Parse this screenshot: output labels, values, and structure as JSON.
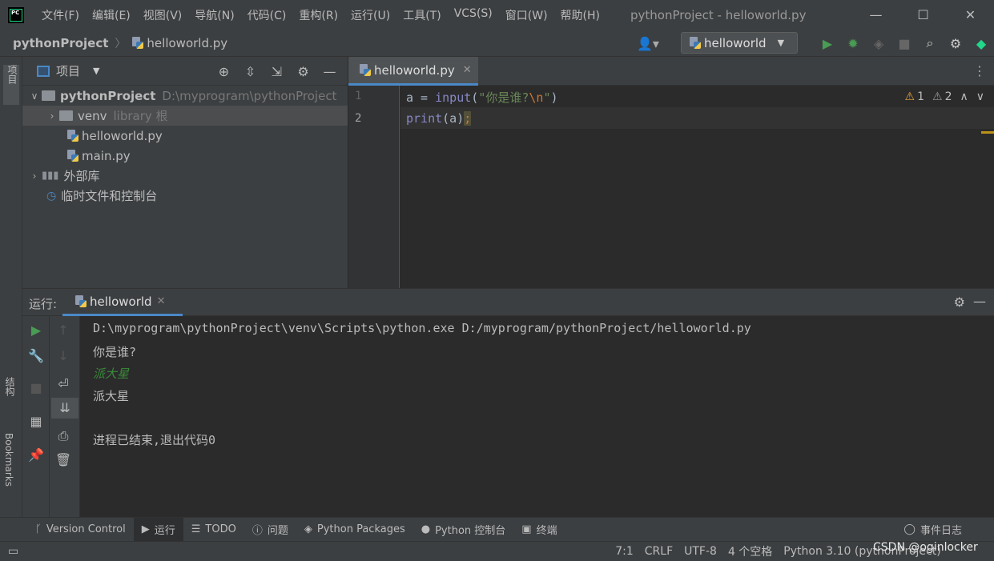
{
  "window": {
    "title": "pythonProject - helloworld.py",
    "menu": [
      "文件(F)",
      "编辑(E)",
      "视图(V)",
      "导航(N)",
      "代码(C)",
      "重构(R)",
      "运行(U)",
      "工具(T)",
      "VCS(S)",
      "窗口(W)",
      "帮助(H)"
    ],
    "controls": {
      "minimize": "—",
      "maximize": "☐",
      "close": "✕"
    }
  },
  "navbar": {
    "project": "pythonProject",
    "file": "helloworld.py",
    "run_config": "helloworld"
  },
  "left_strip": {
    "project_tab": "项目",
    "structure_tab": "结构",
    "bookmarks_tab": "Bookmarks"
  },
  "project_panel": {
    "title": "项目",
    "tree": [
      {
        "label": "pythonProject",
        "path": "D:\\myprogram\\pythonProject"
      },
      {
        "label": "venv",
        "extra": "library 根"
      },
      {
        "label": "helloworld.py"
      },
      {
        "label": "main.py"
      },
      {
        "label": "外部库"
      },
      {
        "label": "临时文件和控制台"
      }
    ]
  },
  "editor": {
    "tab": "helloworld.py",
    "line_numbers": [
      "1",
      "2"
    ],
    "lines": [
      {
        "var": "a",
        "op": " = ",
        "func": "input",
        "open": "(",
        "str1": "\"你是谁?",
        "esc": "\\n",
        "str2": "\"",
        "close": ")"
      },
      {
        "func": "print",
        "rest": "(a)",
        "semi": ";"
      }
    ],
    "warnings": {
      "yellow": "1",
      "gray": "2"
    }
  },
  "run_panel": {
    "label": "运行:",
    "tab": "helloworld",
    "output": [
      "D:\\myprogram\\pythonProject\\venv\\Scripts\\python.exe D:/myprogram/pythonProject/helloworld.py",
      "你是谁?",
      "派大星",
      "派大星",
      "",
      "进程已结束,退出代码0"
    ]
  },
  "bottom_tabs": [
    "Version Control",
    "运行",
    "TODO",
    "问题",
    "Python Packages",
    "Python 控制台",
    "终端"
  ],
  "event_log": "事件日志",
  "status": {
    "position": "7:1",
    "line_sep": "CRLF",
    "encoding": "UTF-8",
    "indent": "4 个空格",
    "interpreter": "Python 3.10 (pythonProject)",
    "watermark": "CSDN @oginlocker"
  },
  "colors": {
    "keyword_func": "#8888c6",
    "string": "#6a8759",
    "escape": "#cc7832",
    "input_echo": "#3a8a3a"
  }
}
